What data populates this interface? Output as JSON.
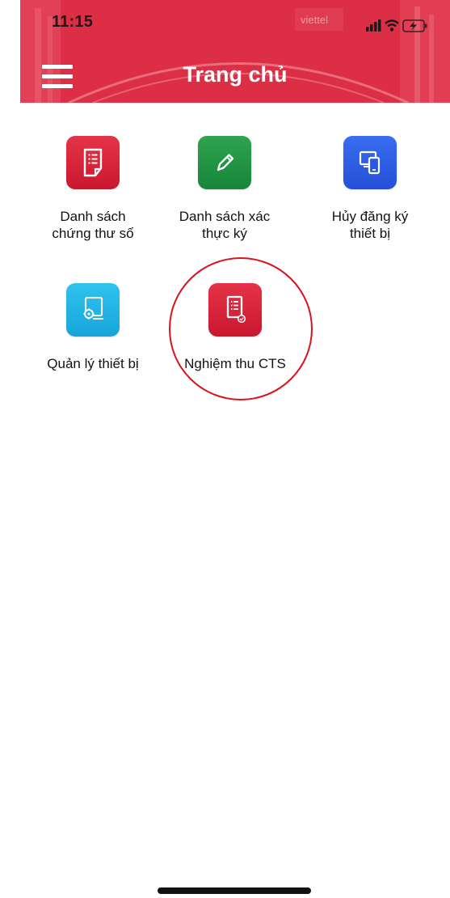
{
  "status_bar": {
    "time": "11:15"
  },
  "header": {
    "title": "Trang chủ",
    "menu_icon": "hamburger-menu-icon",
    "background_color": "#e0364b"
  },
  "grid": {
    "items": [
      {
        "label": "Danh sách chứng thư số",
        "icon": "document-list-icon",
        "color": "#d62239"
      },
      {
        "label": "Danh sách xác thực ký",
        "icon": "pencil-icon",
        "color": "#22943f"
      },
      {
        "label": "Hủy đăng ký thiết bị",
        "icon": "devices-icon",
        "color": "#2f5fe6"
      },
      {
        "label": "Quản lý thiết bị",
        "icon": "device-settings-icon",
        "color": "#22b5e6"
      },
      {
        "label": "Nghiệm thu CTS",
        "icon": "document-check-icon",
        "color": "#d62239"
      }
    ]
  },
  "annotation": {
    "highlight_color": "#d8141c"
  }
}
